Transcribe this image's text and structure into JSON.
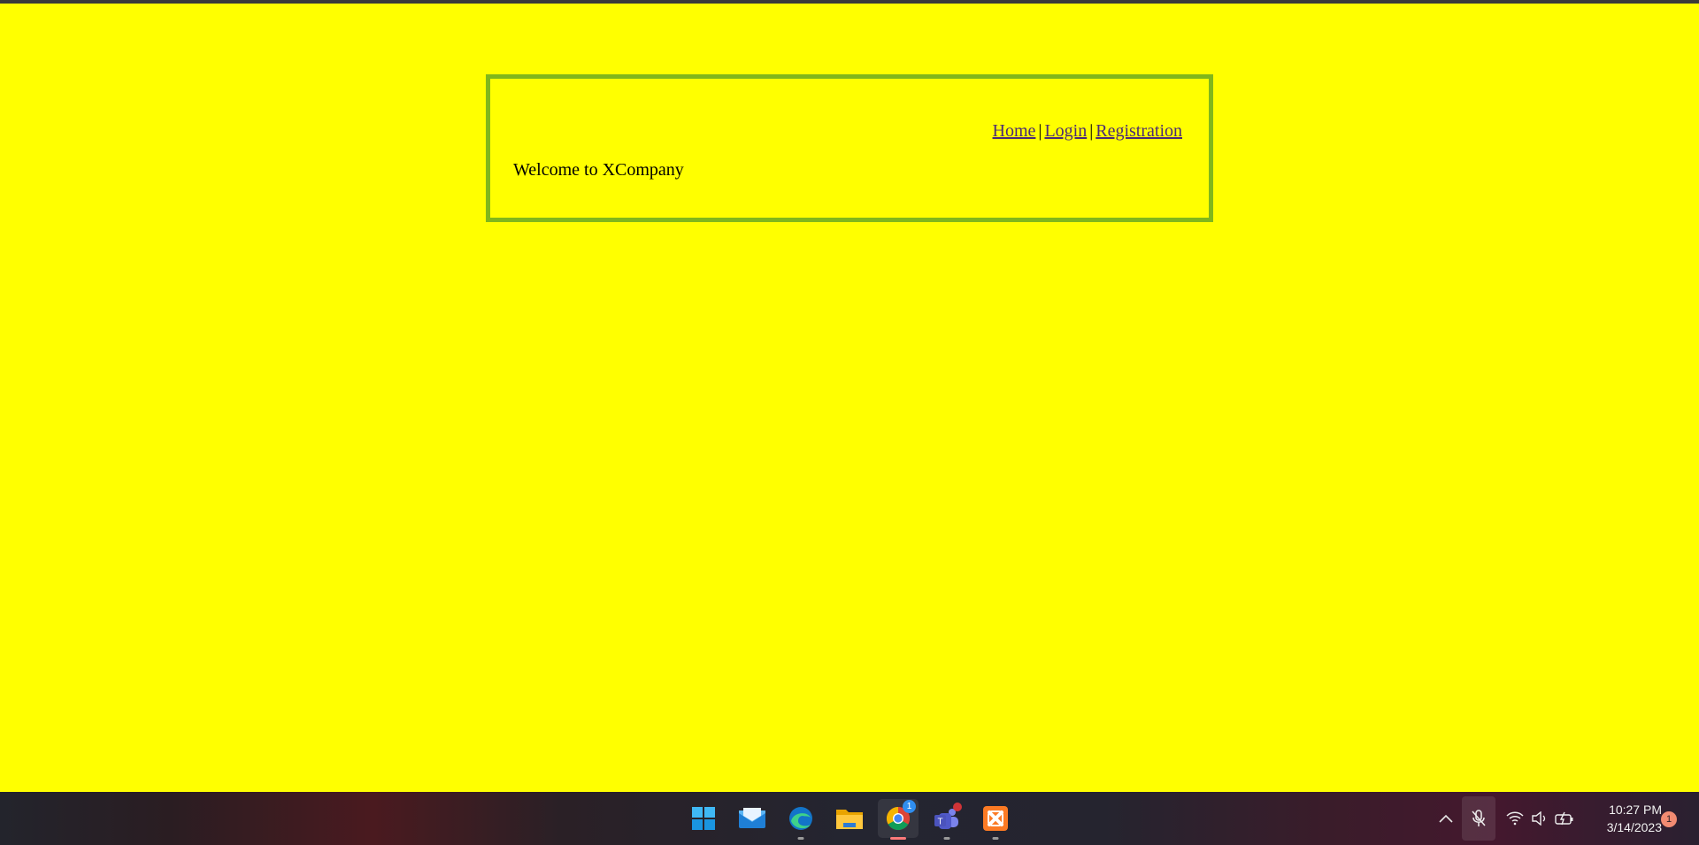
{
  "site": {
    "nav": {
      "home": "Home",
      "login": "Login",
      "registration": "Registration",
      "separator": "|"
    },
    "welcome": "Welcome to XCompany"
  },
  "taskbar": {
    "apps": [
      {
        "name": "start",
        "icon": "windows-start-icon"
      },
      {
        "name": "mail",
        "icon": "mail-icon"
      },
      {
        "name": "edge",
        "icon": "edge-browser-icon"
      },
      {
        "name": "file-explorer",
        "icon": "folder-icon"
      },
      {
        "name": "chrome",
        "icon": "chrome-icon",
        "active": true,
        "badge": "1"
      },
      {
        "name": "teams",
        "icon": "teams-icon"
      },
      {
        "name": "xampp",
        "icon": "xampp-icon"
      }
    ],
    "tray": {
      "clock_time": "10:27 PM",
      "clock_date": "3/14/2023",
      "notification_count": "1"
    }
  },
  "colors": {
    "page_background": "#ffff00",
    "frame_border": "#80b71b",
    "link": "#4b2a74"
  }
}
